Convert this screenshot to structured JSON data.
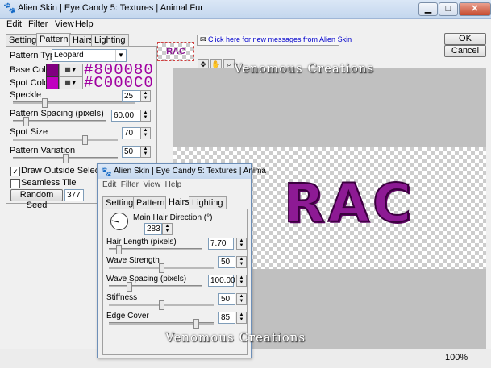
{
  "window": {
    "title": "Alien Skin | Eye Candy 5: Textures | Animal Fur",
    "minimize": "▁",
    "maximize": "□",
    "close": "✕"
  },
  "menu": {
    "edit": "Edit",
    "filter": "Filter",
    "view": "View",
    "help": "Help"
  },
  "tabs": {
    "settings": "Settings",
    "pattern": "Pattern",
    "hairs": "Hairs",
    "lighting": "Lighting"
  },
  "pattern": {
    "type_label": "Pattern Type:",
    "type_value": "Leopard",
    "base_color_label": "Base Color",
    "base_color": "#800080",
    "base_hex": "#800080",
    "spot_color_label": "Spot Color",
    "spot_color": "#C000C0",
    "spot_hex": "#C000C0",
    "speckle_label": "Speckle",
    "speckle_value": "25",
    "speckle_fraction": 0.25,
    "spacing_label": "Pattern Spacing (pixels)",
    "spacing_value": "60.00",
    "spacing_fraction": 0.12,
    "spot_size_label": "Spot Size",
    "spot_size_value": "70",
    "spot_size_fraction": 0.7,
    "variation_label": "Pattern Variation",
    "variation_value": "50",
    "variation_fraction": 0.5,
    "draw_outside_label": "Draw Outside Selection",
    "draw_outside_checked": "✓",
    "seamless_label": "Seamless Tile",
    "random_seed_label": "Random Seed",
    "random_seed_value": "377"
  },
  "top": {
    "thumbnail_text": "RAC",
    "message_link": "Click here for new messages from Alien Skin",
    "ok": "OK",
    "cancel": "Cancel"
  },
  "preview": {
    "text": "RAC",
    "watermark_top": "Venomous Creations",
    "watermark_bottom": "Venomous Creations"
  },
  "status": {
    "zoom": "100%"
  },
  "dialog": {
    "title": "Alien Skin | Eye Candy 5: Textures | Anima",
    "menu_partial": "Edit  Filter  View  Help",
    "hair_direction_label": "Main Hair Direction (°)",
    "hair_direction_value": "283",
    "hair_length_label": "Hair Length (pixels)",
    "hair_length_value": "7.70",
    "hair_length_fraction": 0.08,
    "wave_strength_label": "Wave Strength",
    "wave_strength_value": "50",
    "wave_strength_fraction": 0.5,
    "wave_spacing_label": "Wave Spacing (pixels)",
    "wave_spacing_value": "100.00",
    "wave_spacing_fraction": 0.2,
    "stiffness_label": "Stiffness",
    "stiffness_value": "50",
    "stiffness_fraction": 0.5,
    "edge_cover_label": "Edge Cover",
    "edge_cover_value": "85",
    "edge_cover_fraction": 0.85
  },
  "icons": {
    "app": "paw-icon",
    "hand": "hand-icon",
    "zoom": "zoom-icon",
    "tool": "pan-tool-icon"
  }
}
